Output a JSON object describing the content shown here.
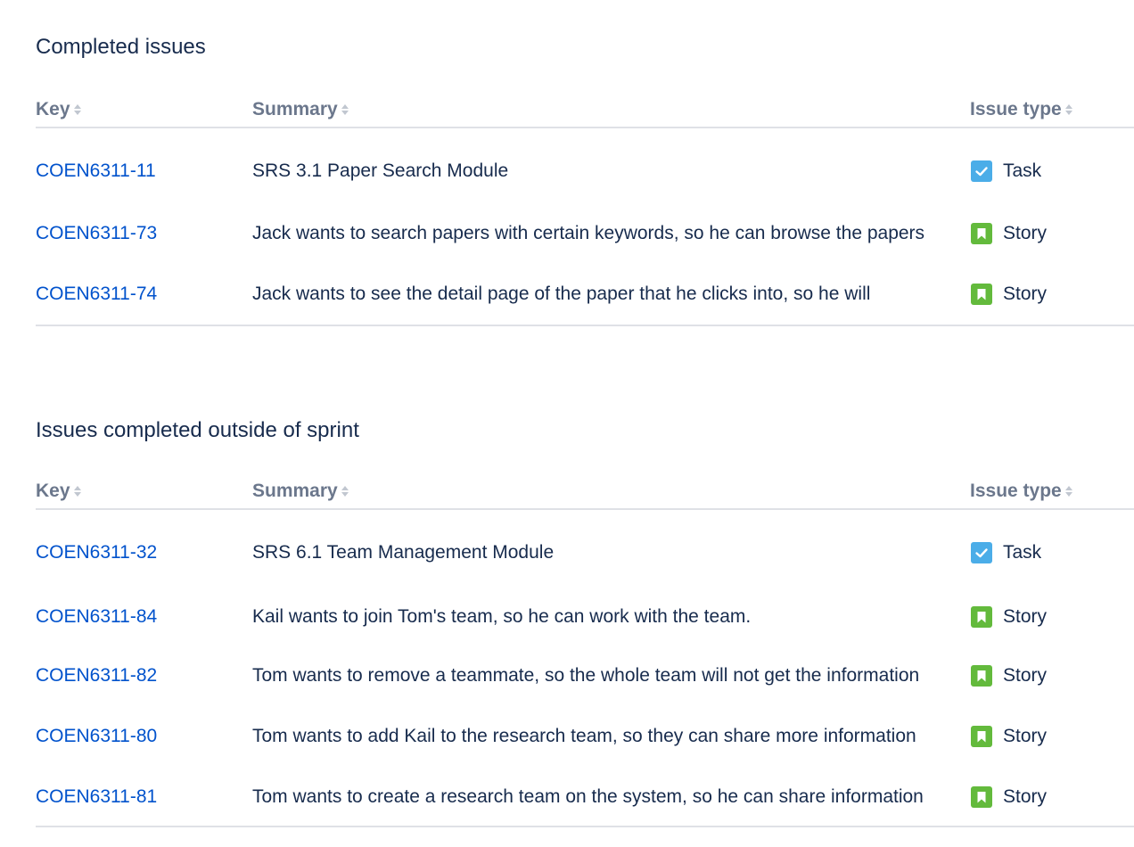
{
  "columns": {
    "key": "Key",
    "summary": "Summary",
    "issue_type": "Issue type"
  },
  "completed": {
    "title": "Completed issues",
    "rows": [
      {
        "key": "COEN6311-11",
        "summary": "SRS 3.1 Paper Search Module",
        "type": "Task",
        "icon": "task-icon"
      },
      {
        "key": "COEN6311-73",
        "summary": "Jack wants to search papers with certain keywords, so he can browse the papers",
        "type": "Story",
        "icon": "story-icon"
      },
      {
        "key": "COEN6311-74",
        "summary": "Jack wants to see the detail page of the paper that he clicks into, so he will",
        "type": "Story",
        "icon": "story-icon"
      }
    ]
  },
  "outside": {
    "title": "Issues completed outside of sprint",
    "rows": [
      {
        "key": "COEN6311-32",
        "summary": "SRS 6.1 Team Management Module",
        "type": "Task",
        "icon": "task-icon"
      },
      {
        "key": "COEN6311-84",
        "summary": "Kail wants to join Tom's team, so he can work with the team.",
        "type": "Story",
        "icon": "story-icon"
      },
      {
        "key": "COEN6311-82",
        "summary": "Tom wants to remove a teammate, so the whole team will not get the information",
        "type": "Story",
        "icon": "story-icon"
      },
      {
        "key": "COEN6311-80",
        "summary": "Tom wants to add Kail to the research team, so they can share more information",
        "type": "Story",
        "icon": "story-icon"
      },
      {
        "key": "COEN6311-81",
        "summary": "Tom wants to create a research team on the system, so he can share information",
        "type": "Story",
        "icon": "story-icon"
      }
    ]
  },
  "colors": {
    "link": "#0052cc",
    "text": "#172b4d",
    "header_text": "#6b778c",
    "task_icon": "#4bade8",
    "story_icon": "#63ba3c",
    "divider": "#dfe1e6"
  }
}
